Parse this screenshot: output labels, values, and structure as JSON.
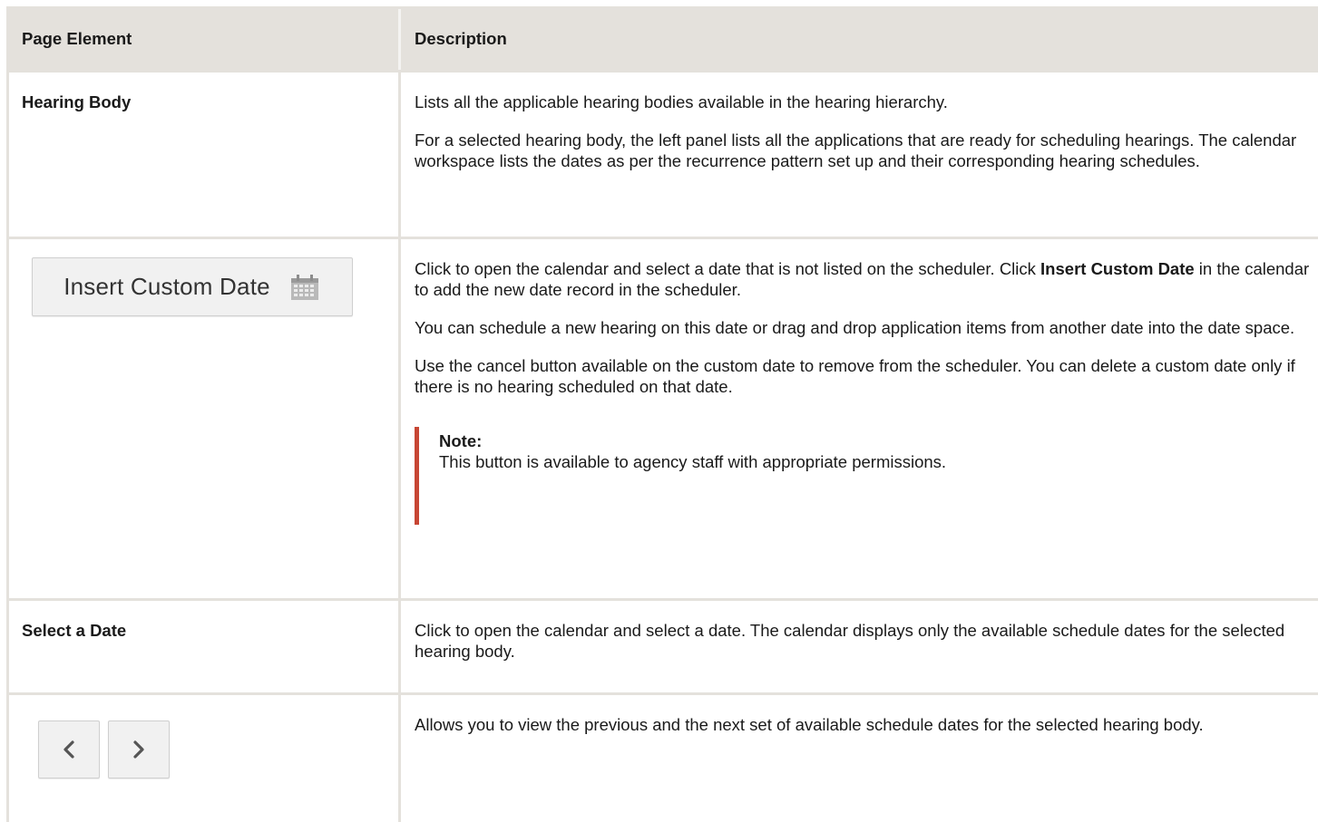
{
  "header": {
    "col1": "Page Element",
    "col2": "Description"
  },
  "rows": [
    {
      "element": "Hearing Body",
      "paragraphs": [
        "Lists all the applicable hearing bodies available in the hearing hierarchy.",
        "For a selected hearing body, the left panel lists all the applications that are ready for scheduling hearings. The calendar workspace lists the dates as per the recurrence pattern set up and their corresponding hearing schedules."
      ]
    },
    {
      "button_label": "Insert Custom Date",
      "button_icon": "calendar-icon",
      "p1_before": "Click to open the calendar and select a date that is not listed on the scheduler. Click ",
      "p1_bold": "Insert Custom Date",
      "p1_after": " in the calendar to add the new date record in the scheduler.",
      "p2": "You can schedule a new hearing on this date or drag and drop application items from another date into the date space.",
      "p3": "Use the cancel button available on the custom date to remove from the scheduler. You can delete a custom date only if there is no hearing scheduled on that date.",
      "note_title": "Note:",
      "note_text": "This button is available to agency staff with appropriate permissions."
    },
    {
      "element": "Select a Date",
      "paragraphs": [
        "Click to open the calendar and select a date. The calendar displays only the available schedule dates for the selected hearing body."
      ]
    },
    {
      "prev_icon": "chevron-left-icon",
      "next_icon": "chevron-right-icon",
      "paragraphs": [
        "Allows you to view the previous and the next set of available schedule dates for the selected hearing body."
      ]
    }
  ],
  "colors": {
    "border": "#e4e1dc",
    "note_accent": "#c74634"
  }
}
